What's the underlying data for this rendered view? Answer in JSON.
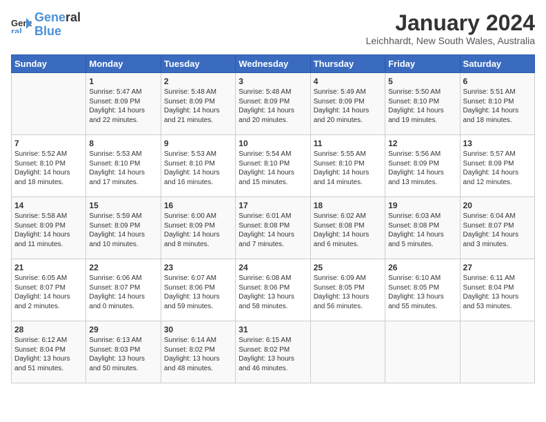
{
  "logo": {
    "line1": "General",
    "line2": "Blue"
  },
  "title": "January 2024",
  "subtitle": "Leichhardt, New South Wales, Australia",
  "weekdays": [
    "Sunday",
    "Monday",
    "Tuesday",
    "Wednesday",
    "Thursday",
    "Friday",
    "Saturday"
  ],
  "weeks": [
    [
      {
        "day": "",
        "info": ""
      },
      {
        "day": "1",
        "info": "Sunrise: 5:47 AM\nSunset: 8:09 PM\nDaylight: 14 hours\nand 22 minutes."
      },
      {
        "day": "2",
        "info": "Sunrise: 5:48 AM\nSunset: 8:09 PM\nDaylight: 14 hours\nand 21 minutes."
      },
      {
        "day": "3",
        "info": "Sunrise: 5:48 AM\nSunset: 8:09 PM\nDaylight: 14 hours\nand 20 minutes."
      },
      {
        "day": "4",
        "info": "Sunrise: 5:49 AM\nSunset: 8:09 PM\nDaylight: 14 hours\nand 20 minutes."
      },
      {
        "day": "5",
        "info": "Sunrise: 5:50 AM\nSunset: 8:10 PM\nDaylight: 14 hours\nand 19 minutes."
      },
      {
        "day": "6",
        "info": "Sunrise: 5:51 AM\nSunset: 8:10 PM\nDaylight: 14 hours\nand 18 minutes."
      }
    ],
    [
      {
        "day": "7",
        "info": "Sunrise: 5:52 AM\nSunset: 8:10 PM\nDaylight: 14 hours\nand 18 minutes."
      },
      {
        "day": "8",
        "info": "Sunrise: 5:53 AM\nSunset: 8:10 PM\nDaylight: 14 hours\nand 17 minutes."
      },
      {
        "day": "9",
        "info": "Sunrise: 5:53 AM\nSunset: 8:10 PM\nDaylight: 14 hours\nand 16 minutes."
      },
      {
        "day": "10",
        "info": "Sunrise: 5:54 AM\nSunset: 8:10 PM\nDaylight: 14 hours\nand 15 minutes."
      },
      {
        "day": "11",
        "info": "Sunrise: 5:55 AM\nSunset: 8:10 PM\nDaylight: 14 hours\nand 14 minutes."
      },
      {
        "day": "12",
        "info": "Sunrise: 5:56 AM\nSunset: 8:09 PM\nDaylight: 14 hours\nand 13 minutes."
      },
      {
        "day": "13",
        "info": "Sunrise: 5:57 AM\nSunset: 8:09 PM\nDaylight: 14 hours\nand 12 minutes."
      }
    ],
    [
      {
        "day": "14",
        "info": "Sunrise: 5:58 AM\nSunset: 8:09 PM\nDaylight: 14 hours\nand 11 minutes."
      },
      {
        "day": "15",
        "info": "Sunrise: 5:59 AM\nSunset: 8:09 PM\nDaylight: 14 hours\nand 10 minutes."
      },
      {
        "day": "16",
        "info": "Sunrise: 6:00 AM\nSunset: 8:09 PM\nDaylight: 14 hours\nand 8 minutes."
      },
      {
        "day": "17",
        "info": "Sunrise: 6:01 AM\nSunset: 8:08 PM\nDaylight: 14 hours\nand 7 minutes."
      },
      {
        "day": "18",
        "info": "Sunrise: 6:02 AM\nSunset: 8:08 PM\nDaylight: 14 hours\nand 6 minutes."
      },
      {
        "day": "19",
        "info": "Sunrise: 6:03 AM\nSunset: 8:08 PM\nDaylight: 14 hours\nand 5 minutes."
      },
      {
        "day": "20",
        "info": "Sunrise: 6:04 AM\nSunset: 8:07 PM\nDaylight: 14 hours\nand 3 minutes."
      }
    ],
    [
      {
        "day": "21",
        "info": "Sunrise: 6:05 AM\nSunset: 8:07 PM\nDaylight: 14 hours\nand 2 minutes."
      },
      {
        "day": "22",
        "info": "Sunrise: 6:06 AM\nSunset: 8:07 PM\nDaylight: 14 hours\nand 0 minutes."
      },
      {
        "day": "23",
        "info": "Sunrise: 6:07 AM\nSunset: 8:06 PM\nDaylight: 13 hours\nand 59 minutes."
      },
      {
        "day": "24",
        "info": "Sunrise: 6:08 AM\nSunset: 8:06 PM\nDaylight: 13 hours\nand 58 minutes."
      },
      {
        "day": "25",
        "info": "Sunrise: 6:09 AM\nSunset: 8:05 PM\nDaylight: 13 hours\nand 56 minutes."
      },
      {
        "day": "26",
        "info": "Sunrise: 6:10 AM\nSunset: 8:05 PM\nDaylight: 13 hours\nand 55 minutes."
      },
      {
        "day": "27",
        "info": "Sunrise: 6:11 AM\nSunset: 8:04 PM\nDaylight: 13 hours\nand 53 minutes."
      }
    ],
    [
      {
        "day": "28",
        "info": "Sunrise: 6:12 AM\nSunset: 8:04 PM\nDaylight: 13 hours\nand 51 minutes."
      },
      {
        "day": "29",
        "info": "Sunrise: 6:13 AM\nSunset: 8:03 PM\nDaylight: 13 hours\nand 50 minutes."
      },
      {
        "day": "30",
        "info": "Sunrise: 6:14 AM\nSunset: 8:02 PM\nDaylight: 13 hours\nand 48 minutes."
      },
      {
        "day": "31",
        "info": "Sunrise: 6:15 AM\nSunset: 8:02 PM\nDaylight: 13 hours\nand 46 minutes."
      },
      {
        "day": "",
        "info": ""
      },
      {
        "day": "",
        "info": ""
      },
      {
        "day": "",
        "info": ""
      }
    ]
  ]
}
